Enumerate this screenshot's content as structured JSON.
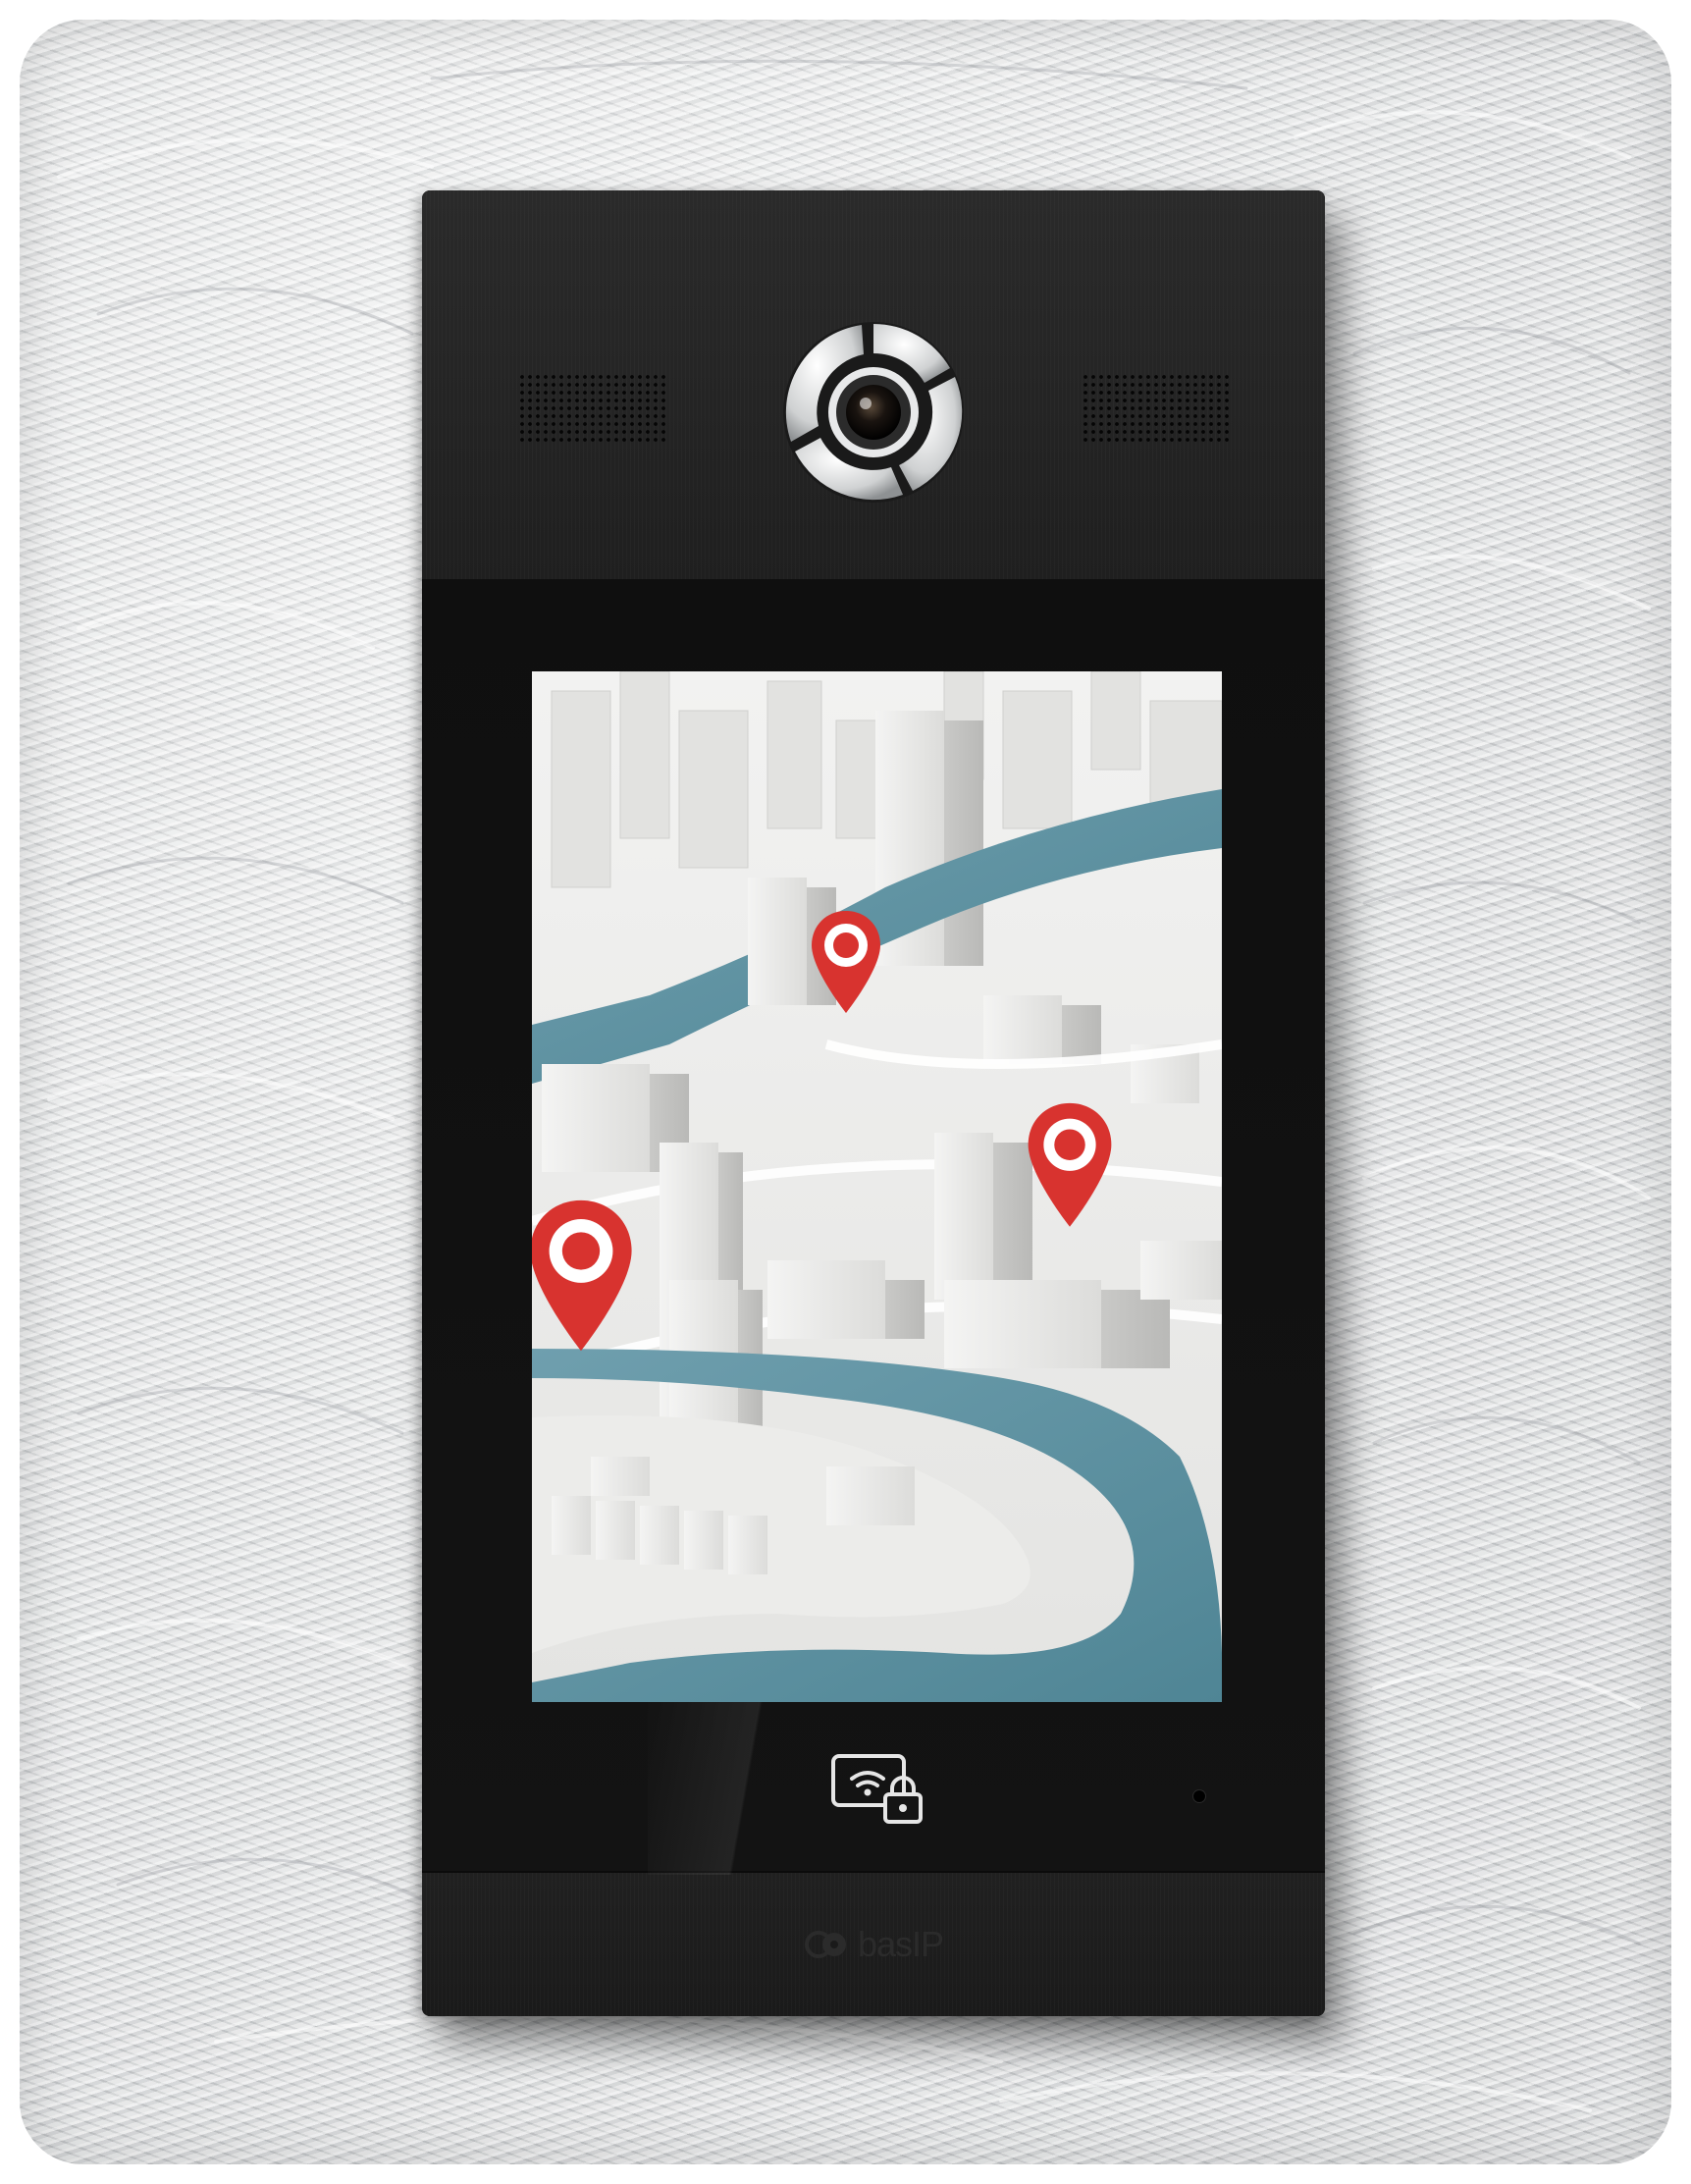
{
  "scene": {
    "wall_color": "#d4d6d7",
    "panel_color": "#141414",
    "water_color": "#5f94a4",
    "pin_color": "#d8332f"
  },
  "device": {
    "brand_text": "basIP",
    "icons": [
      "camera-lens-icon",
      "speaker-grille-icon",
      "card-reader-icon",
      "lock-icon",
      "map-pin-icon"
    ]
  },
  "screen": {
    "content": "3d-city-map",
    "pin_count": 3
  }
}
